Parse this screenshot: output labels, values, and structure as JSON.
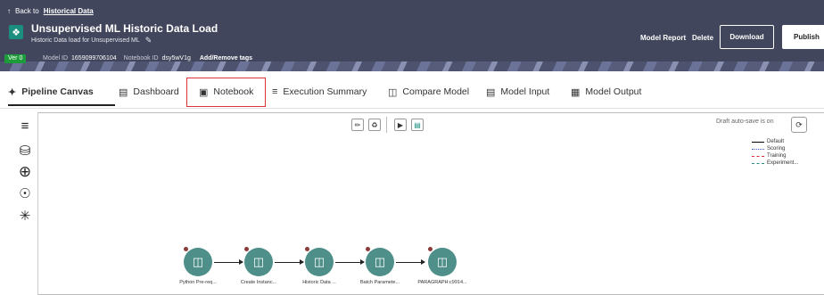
{
  "header": {
    "back_label": "Back to",
    "back_link": "Historical Data",
    "title": "Unsupervised ML Historic Data Load",
    "subtitle": "Historic Data load for Unsupervised ML",
    "version": "Ver 0",
    "model_id_label": "Model ID",
    "model_id": "1659099706104",
    "notebook_id_label": "Notebook ID",
    "notebook_id": "dsy5wV1g",
    "tags_link": "Add/Remove tags",
    "model_report": "Model Report",
    "delete": "Delete",
    "download": "Download",
    "publish": "Publish"
  },
  "tabs": [
    {
      "label": "Pipeline Canvas",
      "icon": "pipeline-icon"
    },
    {
      "label": "Dashboard",
      "icon": "dashboard-icon"
    },
    {
      "label": "Notebook",
      "icon": "notebook-icon"
    },
    {
      "label": "Execution Summary",
      "icon": "list-icon"
    },
    {
      "label": "Compare Model",
      "icon": "map-icon"
    },
    {
      "label": "Model Input",
      "icon": "form-icon"
    },
    {
      "label": "Model Output",
      "icon": "output-icon"
    }
  ],
  "canvas": {
    "autosave": "Draft auto-save is on",
    "legend": [
      {
        "label": "Default",
        "color": "#000000",
        "style": "solid"
      },
      {
        "label": "Scoring",
        "color": "#3a5bc7",
        "style": "dotted"
      },
      {
        "label": "Training",
        "color": "#e0303a",
        "style": "dashed"
      },
      {
        "label": "Experiment...",
        "color": "#2a8f8a",
        "style": "dashed"
      }
    ],
    "nodes": [
      {
        "label": "Python Pre-req..."
      },
      {
        "label": "Create Instanc..."
      },
      {
        "label": "Historic Data ..."
      },
      {
        "label": "Batch Paramete..."
      },
      {
        "label": "PARAGRAPH:c9914..."
      }
    ]
  },
  "colors": {
    "header_bg": "#42465c",
    "accent": "#1b8e7e",
    "node": "#4e8f8a",
    "highlight": "#e0303a",
    "version_badge": "#1d9b3a"
  }
}
